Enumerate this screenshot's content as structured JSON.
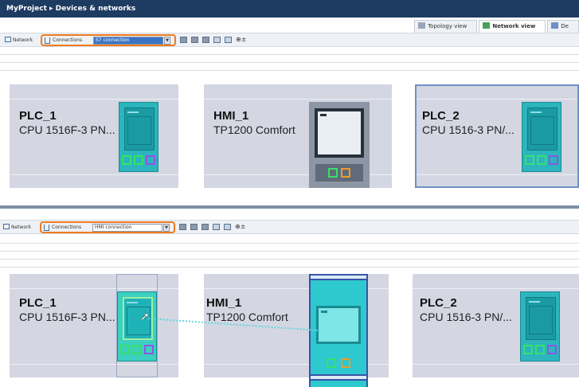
{
  "titlebar": {
    "breadcrumb": "MyProject  ▸  Devices & networks"
  },
  "view_tabs": [
    {
      "label": "Topology view",
      "icon": "topology-icon"
    },
    {
      "label": "Network view",
      "icon": "network-icon",
      "active": true
    },
    {
      "label": "De",
      "icon": "device-view-icon"
    }
  ],
  "toolbar_top": {
    "network_label": "Network",
    "connections_label": "Connections",
    "connection_type": "S7 connection"
  },
  "toolbar_bottom": {
    "network_label": "Network",
    "connections_label": "Connections",
    "connection_type": "HMI connection"
  },
  "devices_top": [
    {
      "name": "PLC_1",
      "type": "CPU 1516F-3 PN..."
    },
    {
      "name": "HMI_1",
      "type": "TP1200 Comfort"
    },
    {
      "name": "PLC_2",
      "type": "CPU 1516-3 PN/..."
    }
  ],
  "devices_bottom": [
    {
      "name": "PLC_1",
      "type": "CPU 1516F-3 PN..."
    },
    {
      "name": "HMI_1",
      "type": "TP1200 Comfort"
    },
    {
      "name": "PLC_2",
      "type": "CPU 1516-3 PN/..."
    }
  ],
  "colors": {
    "accent_highlight": "#f07b1f",
    "plc_teal": "#2cb5bd",
    "title_bar": "#1e3b61",
    "connection_line": "#62d7de"
  }
}
